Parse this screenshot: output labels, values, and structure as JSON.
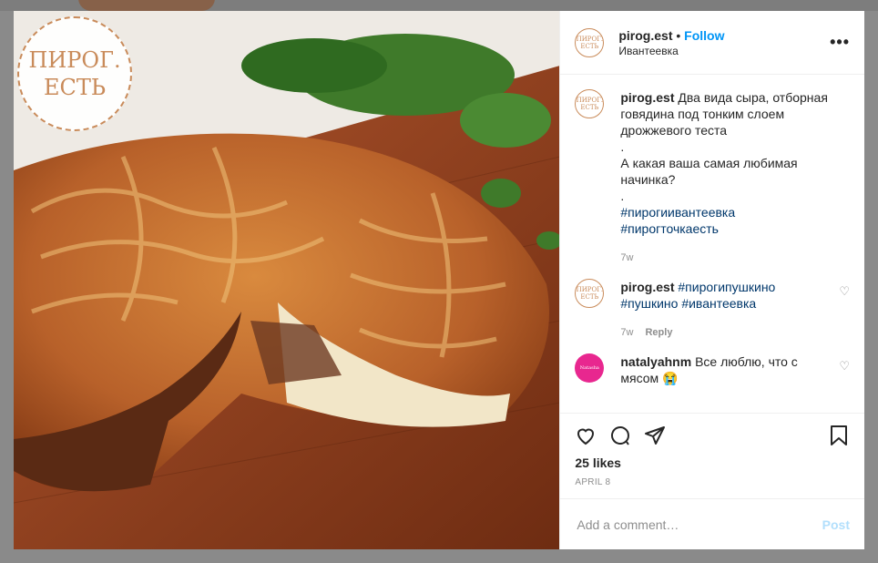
{
  "photo": {
    "logo_line1": "ПИРОГ.",
    "logo_line2": "ЕСТЬ",
    "alt": "pie on a wooden board"
  },
  "header": {
    "username": "pirog.est",
    "separator": "•",
    "follow_label": "Follow",
    "location": "Ивантеевка",
    "more_label": "•••",
    "avatar_line1": "ПИРОГ.",
    "avatar_line2": "ЕСТЬ"
  },
  "comments": [
    {
      "username": "pirog.est",
      "lines": [
        "Два вида сыра, отборная говядина под тонким слоем дрожжевого теста",
        ".",
        "А какая ваша самая любимая начинка?",
        "."
      ],
      "tags": [
        "#пирогиивантеевка",
        "#пирогточкаесть"
      ],
      "time": "7w"
    },
    {
      "username": "pirog.est",
      "tags": [
        "#пирогипушкино",
        "#пушкино",
        "#ивантеевка"
      ],
      "time": "7w",
      "reply_label": "Reply"
    },
    {
      "username": "natalyahnm",
      "text": "Все люблю, что с мясом 😭",
      "avatar_text": "Natasha"
    }
  ],
  "actions": {
    "likes": "25 likes",
    "date": "APRIL 8"
  },
  "add_comment": {
    "placeholder": "Add a comment…",
    "post_label": "Post"
  },
  "icons": {
    "like": "heart-icon",
    "comment": "comment-icon",
    "share": "share-icon",
    "save": "bookmark-icon",
    "comment_like": "small-heart-icon"
  }
}
